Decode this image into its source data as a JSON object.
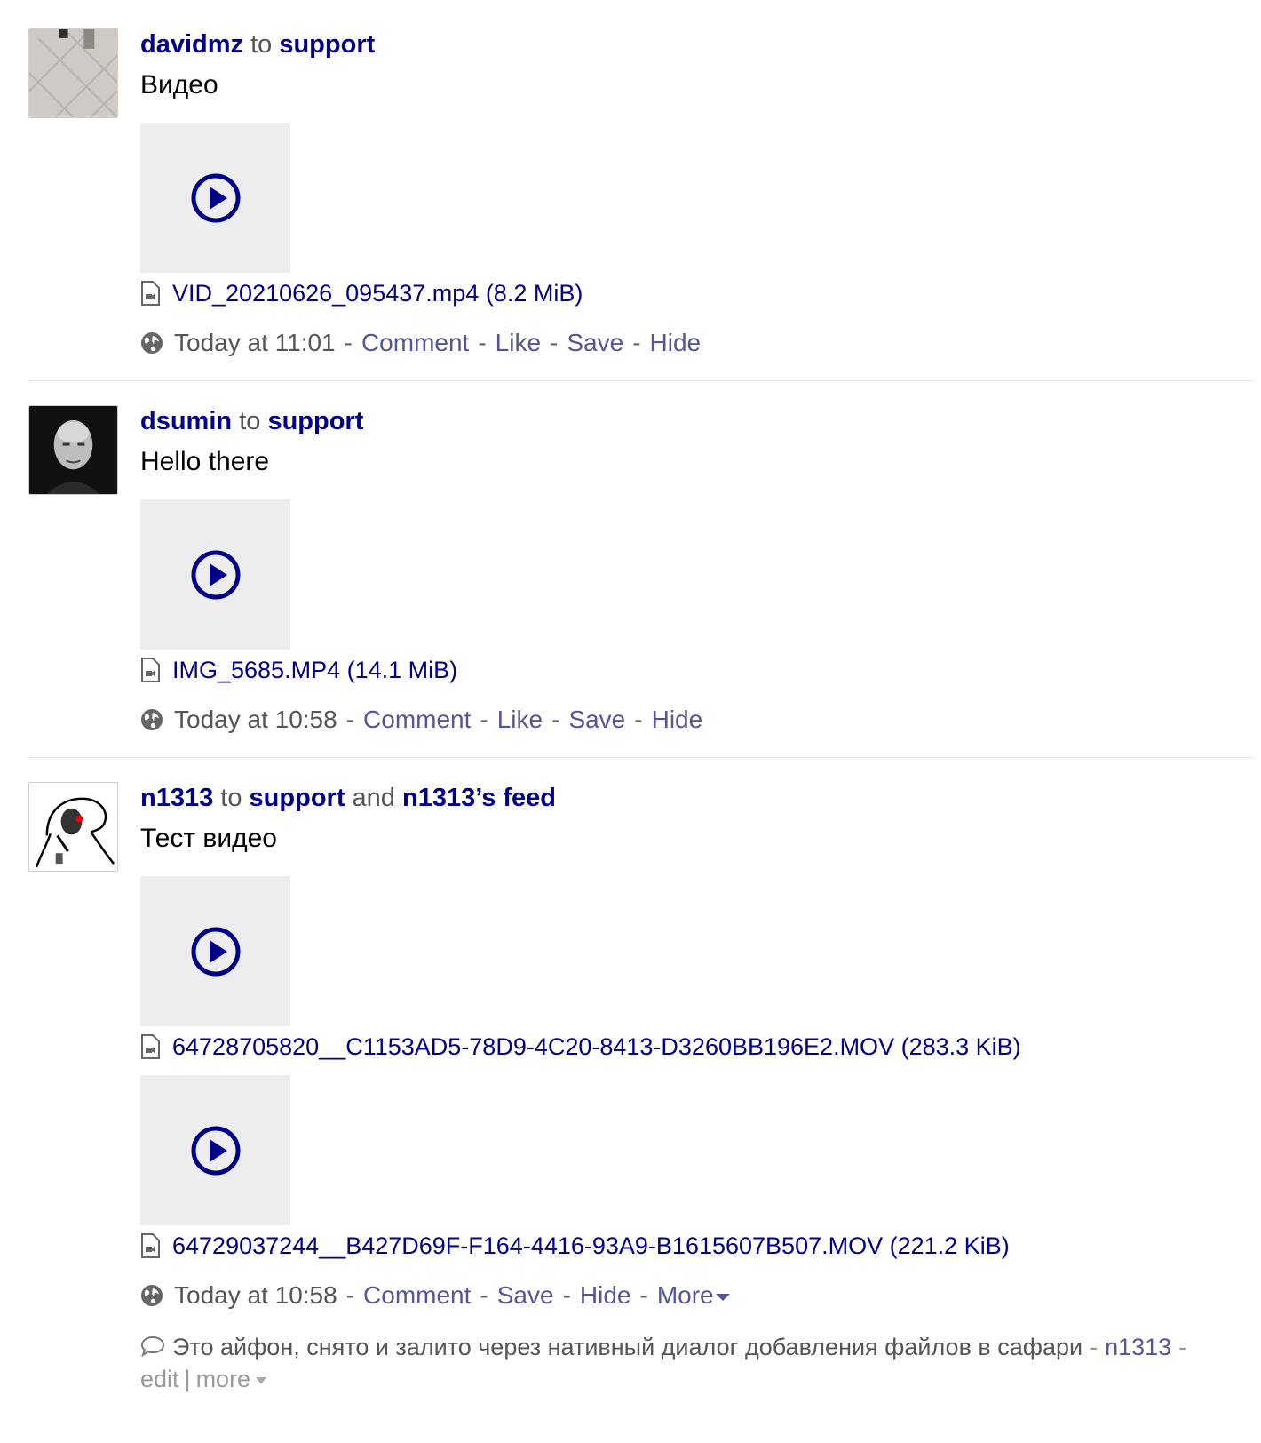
{
  "posts": [
    {
      "author": "davidmz",
      "to_word": "to",
      "target": "support",
      "body": "Видео",
      "attachments": [
        {
          "file_name": "VID_20210626_095437.mp4",
          "file_size": "(8.2 MiB)"
        }
      ],
      "time": "Today at 11:01",
      "actions": [
        "Comment",
        "Like",
        "Save",
        "Hide"
      ]
    },
    {
      "author": "dsumin",
      "to_word": "to",
      "target": "support",
      "body": "Hello there",
      "attachments": [
        {
          "file_name": "IMG_5685.MP4",
          "file_size": "(14.1 MiB)"
        }
      ],
      "time": "Today at 10:58",
      "actions": [
        "Comment",
        "Like",
        "Save",
        "Hide"
      ]
    },
    {
      "author": "n1313",
      "to_word": "to",
      "target": "support",
      "and_word": "and",
      "target2": "n1313’s feed",
      "body": "Тест видео",
      "attachments": [
        {
          "file_name": "64728705820__C1153AD5-78D9-4C20-8413-D3260BB196E2.MOV",
          "file_size": "(283.3 KiB)"
        },
        {
          "file_name": "64729037244__B427D69F-F164-4416-93A9-B1615607B507.MOV",
          "file_size": "(221.2 KiB)"
        }
      ],
      "time": "Today at 10:58",
      "actions": [
        "Comment",
        "Save",
        "Hide",
        "More"
      ],
      "comment": {
        "text": "Это айфон, снято и залито через нативный диалог добавления файлов в сафари",
        "author": "n1313",
        "edit_label": "edit",
        "more_label": "more"
      }
    }
  ],
  "colors": {
    "link": "#000088",
    "action_link": "#555599",
    "muted_text": "#555555",
    "thumb_bg": "#ededed"
  },
  "icons": [
    "play-icon",
    "video-file-icon",
    "globe-icon",
    "comment-bubble-icon",
    "caret-down-icon"
  ]
}
